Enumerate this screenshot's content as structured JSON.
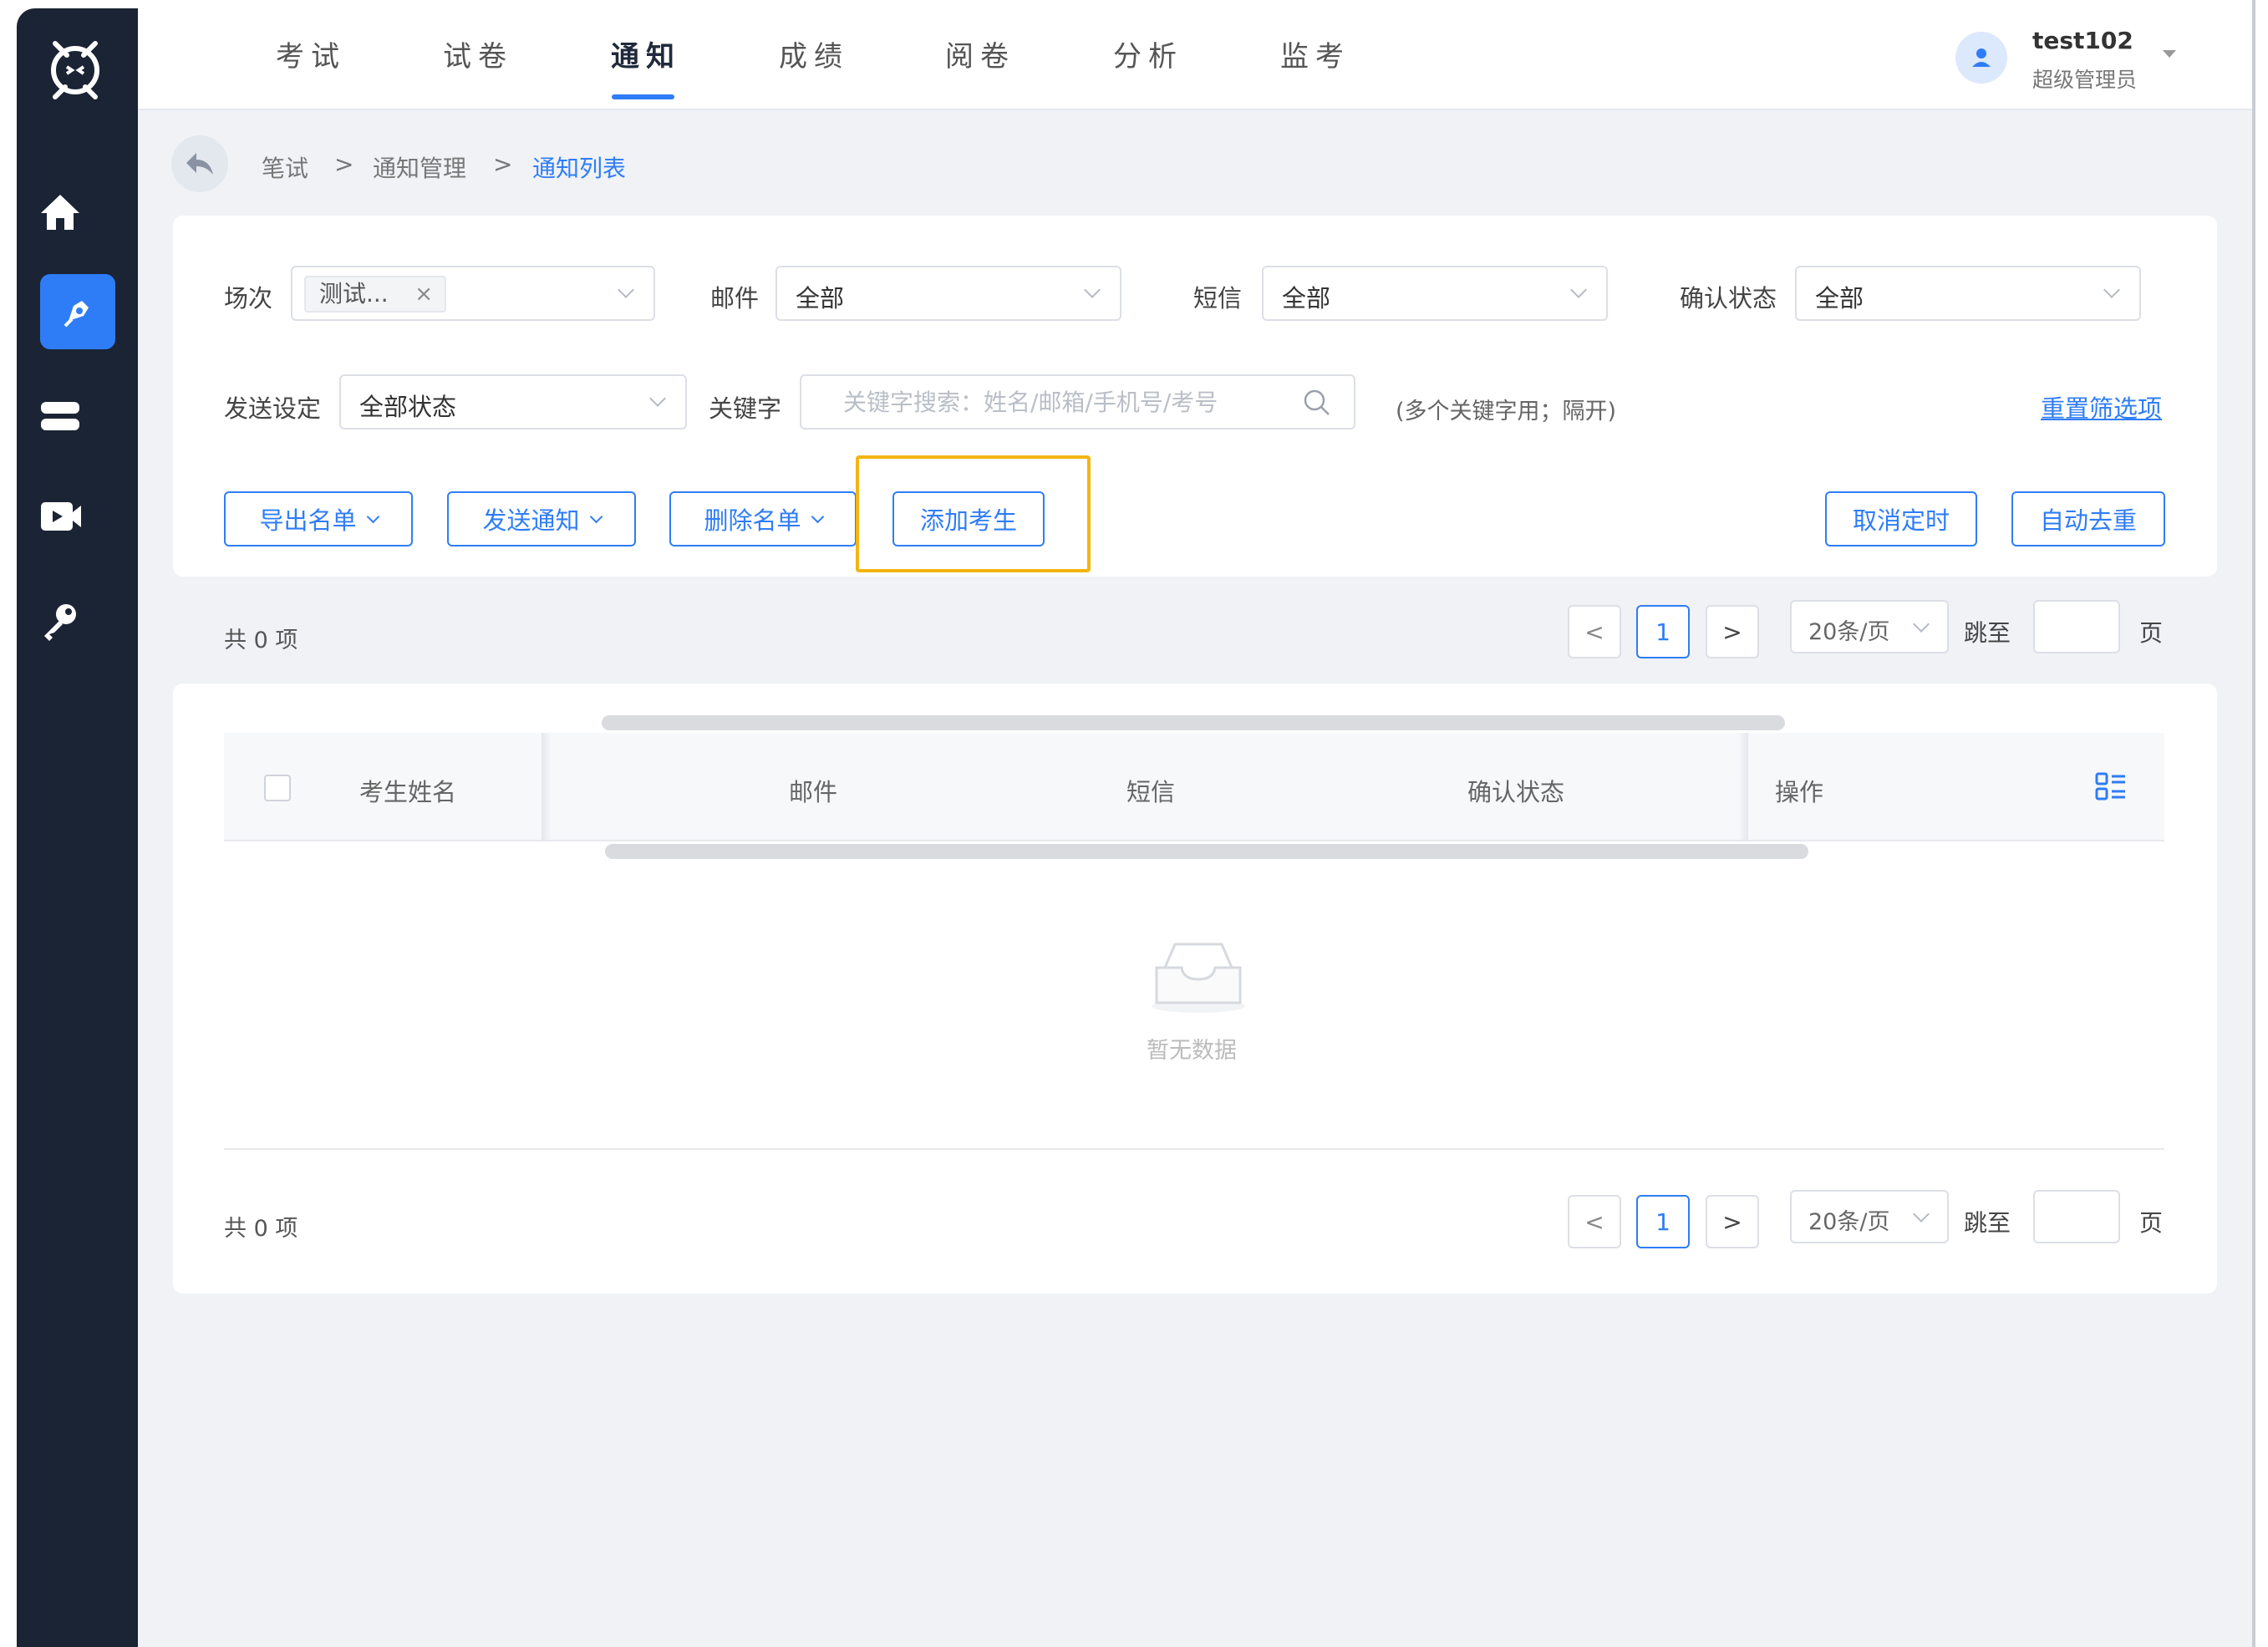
{
  "nav": {
    "tabs": [
      {
        "label": "考试"
      },
      {
        "label": "试卷"
      },
      {
        "label": "通知"
      },
      {
        "label": "成绩"
      },
      {
        "label": "阅卷"
      },
      {
        "label": "分析"
      },
      {
        "label": "监考"
      }
    ],
    "active_tab": "通知",
    "accent_color": "#2f7df6"
  },
  "user": {
    "name": "test102",
    "role": "超级管理员",
    "avatar_icon": "user-icon"
  },
  "breadcrumb": {
    "items": [
      "笔试",
      "通知管理",
      "通知列表"
    ],
    "separator": ">"
  },
  "filters": {
    "session": {
      "label": "场次",
      "tag": "测试...",
      "tag_close": "×"
    },
    "email": {
      "label": "邮件",
      "value": "全部"
    },
    "sms": {
      "label": "短信",
      "value": "全部"
    },
    "confirm": {
      "label": "确认状态",
      "value": "全部"
    },
    "send_setting": {
      "label": "发送设定",
      "value": "全部状态"
    },
    "keyword": {
      "label": "关键字",
      "placeholder": "关键字搜索：姓名/邮箱/手机号/考号",
      "value": ""
    },
    "hint": "(多个关键字用；隔开)",
    "reset": "重置筛选项"
  },
  "actions": {
    "export": "导出名单",
    "send": "发送通知",
    "delete": "删除名单",
    "add": "添加考生",
    "cancel_timer": "取消定时",
    "dedupe": "自动去重"
  },
  "pagination": {
    "total": "共 0 项",
    "current_page": "1",
    "prev": "<",
    "next": ">",
    "page_size": "20条/页",
    "jump_label": "跳至",
    "page_suffix": "页"
  },
  "table": {
    "columns": [
      "考生姓名",
      "邮件",
      "短信",
      "确认状态",
      "操作"
    ],
    "empty_text": "暂无数据",
    "rows": []
  },
  "highlight_color": "#f3b512"
}
